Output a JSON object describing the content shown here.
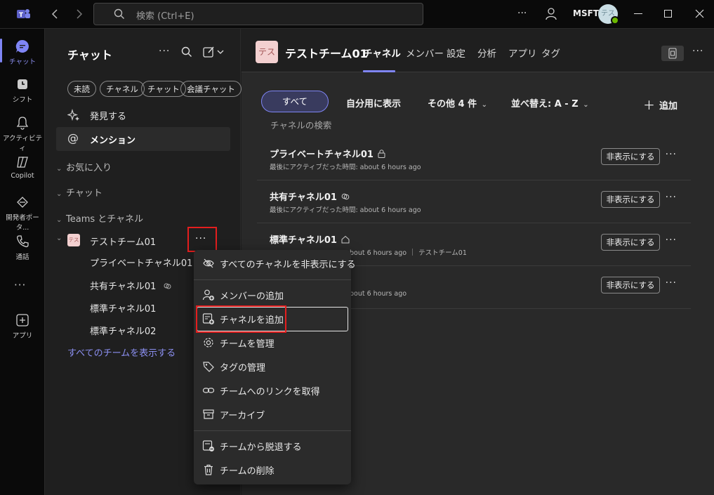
{
  "titlebar": {
    "search_placeholder": "検索 (Ctrl+E)",
    "org": "MSFT",
    "avatar_initials": "テス"
  },
  "rail": [
    {
      "label": "チャット",
      "icon": "chat-icon"
    },
    {
      "label": "シフト",
      "icon": "shifts-icon"
    },
    {
      "label": "アクティビティ",
      "icon": "bell-icon"
    },
    {
      "label": "Copilot",
      "icon": "copilot-icon"
    },
    {
      "label": "開発者ポータ...",
      "icon": "developer-portal-icon"
    },
    {
      "label": "通話",
      "icon": "phone-icon"
    },
    {
      "label": "アプリ",
      "icon": "apps-icon"
    }
  ],
  "side": {
    "title": "チャット",
    "filters": [
      "未読",
      "チャネル",
      "チャット",
      "会議チャット"
    ],
    "discover": "発見する",
    "mentions": "メンション",
    "favorites": "お気に入り",
    "chats": "チャット",
    "teams_header": "Teams とチャネル",
    "team": {
      "avatar": "テス",
      "name": "テストチーム01"
    },
    "channels": [
      "プライベートチャネル01",
      "共有チャネル01",
      "標準チャネル01",
      "標準チャネル02"
    ],
    "show_all": "すべてのチームを表示する"
  },
  "main": {
    "team_avatar": "テス",
    "team_name": "テストチーム01",
    "tabs": [
      "チャネル",
      "メンバー",
      "設定",
      "分析",
      "アプリ",
      "タグ"
    ],
    "filters": {
      "all": "すべて",
      "mine": "自分用に表示",
      "other": "その他 4 件",
      "sort": "並べ替え: A - Z",
      "add": "追加"
    },
    "search_placeholder": "チャネルの検索",
    "channel_rows": [
      {
        "name": "プライベートチャネル01",
        "meta": "最後にアクティブだった時間: about 6 hours ago",
        "button": "非表示にする"
      },
      {
        "name": "共有チャネル01",
        "meta": "最後にアクティブだった時間: about 6 hours ago",
        "button": "非表示にする"
      },
      {
        "name": "標準チャネル01",
        "meta": "bout 6 hours ago",
        "team_tag": "テストチーム01",
        "button": "非表示にする"
      },
      {
        "name": "",
        "meta": "bout 6 hours ago",
        "button": "非表示にする"
      }
    ]
  },
  "menu": {
    "items": [
      {
        "label": "すべてのチャネルを非表示にする",
        "icon": "eye-off-icon"
      },
      {
        "label": "メンバーの追加",
        "icon": "person-add-icon"
      },
      {
        "label": "チャネルを追加",
        "icon": "channel-add-icon"
      },
      {
        "label": "チームを管理",
        "icon": "gear-icon"
      },
      {
        "label": "タグの管理",
        "icon": "tag-icon"
      },
      {
        "label": "チームへのリンクを取得",
        "icon": "link-icon"
      },
      {
        "label": "アーカイブ",
        "icon": "archive-icon"
      },
      {
        "label": "チームから脱退する",
        "icon": "leave-icon"
      },
      {
        "label": "チームの削除",
        "icon": "trash-icon"
      }
    ]
  },
  "colors": {
    "accent": "#7f85f5",
    "highlight": "#e41e1e"
  }
}
